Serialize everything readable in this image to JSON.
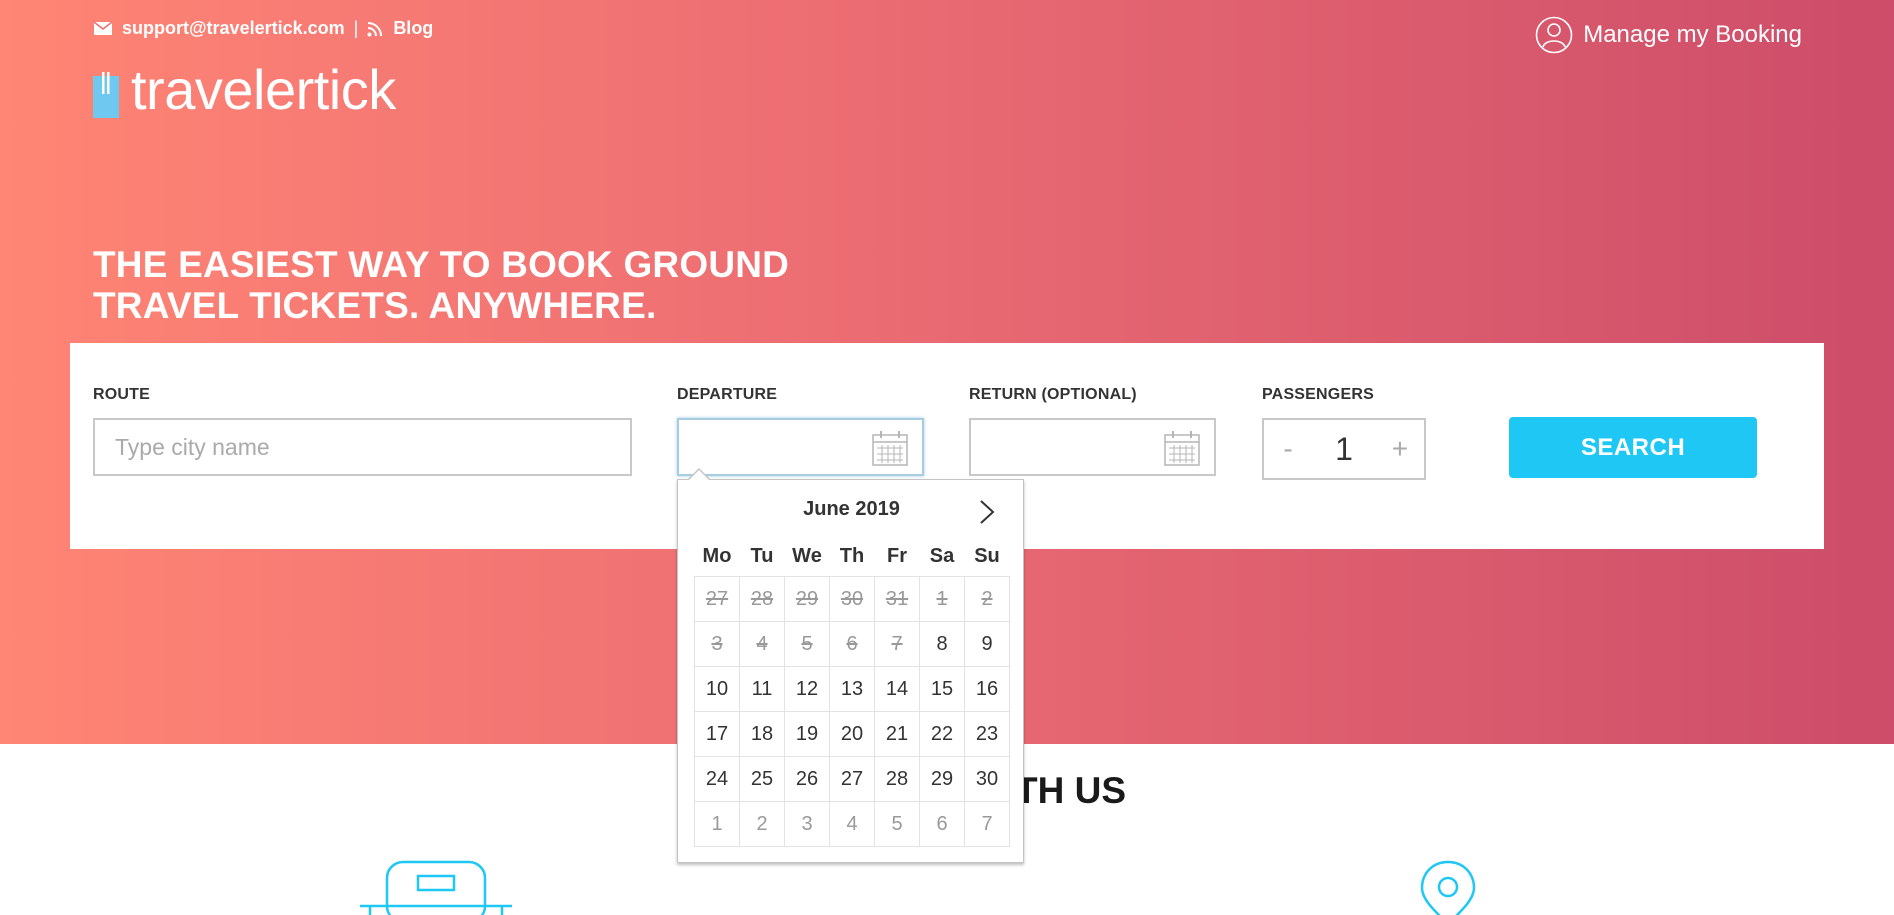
{
  "header": {
    "email": "support@travelertick.com",
    "separator": "|",
    "blog": "Blog",
    "manage_booking": "Manage my Booking",
    "logo_text": "travelertick"
  },
  "hero": {
    "headline_line1": "THE EASIEST WAY TO BOOK GROUND",
    "headline_line2": "TRAVEL TICKETS. ANYWHERE."
  },
  "search_form": {
    "route_label": "ROUTE",
    "route_placeholder": "Type city name",
    "route_value": "",
    "departure_label": "DEPARTURE",
    "departure_value": "",
    "return_label": "RETURN (OPTIONAL)",
    "return_value": "",
    "passengers_label": "PASSENGERS",
    "passengers_minus": "-",
    "passengers_value": "1",
    "passengers_plus": "+",
    "search_button": "SEARCH"
  },
  "below": {
    "section_title_visible": "TH US"
  },
  "datepicker": {
    "month_label": "June 2019",
    "weekdays": [
      "Mo",
      "Tu",
      "We",
      "Th",
      "Fr",
      "Sa",
      "Su"
    ],
    "weeks": [
      [
        {
          "d": "27",
          "s": "past"
        },
        {
          "d": "28",
          "s": "past"
        },
        {
          "d": "29",
          "s": "past"
        },
        {
          "d": "30",
          "s": "past"
        },
        {
          "d": "31",
          "s": "past"
        },
        {
          "d": "1",
          "s": "past"
        },
        {
          "d": "2",
          "s": "past"
        }
      ],
      [
        {
          "d": "3",
          "s": "past"
        },
        {
          "d": "4",
          "s": "past"
        },
        {
          "d": "5",
          "s": "past"
        },
        {
          "d": "6",
          "s": "past"
        },
        {
          "d": "7",
          "s": "past"
        },
        {
          "d": "8",
          "s": "avail"
        },
        {
          "d": "9",
          "s": "avail"
        }
      ],
      [
        {
          "d": "10",
          "s": "avail"
        },
        {
          "d": "11",
          "s": "avail"
        },
        {
          "d": "12",
          "s": "avail"
        },
        {
          "d": "13",
          "s": "avail"
        },
        {
          "d": "14",
          "s": "avail"
        },
        {
          "d": "15",
          "s": "avail"
        },
        {
          "d": "16",
          "s": "avail"
        }
      ],
      [
        {
          "d": "17",
          "s": "avail"
        },
        {
          "d": "18",
          "s": "avail"
        },
        {
          "d": "19",
          "s": "avail"
        },
        {
          "d": "20",
          "s": "avail"
        },
        {
          "d": "21",
          "s": "avail"
        },
        {
          "d": "22",
          "s": "avail"
        },
        {
          "d": "23",
          "s": "avail"
        }
      ],
      [
        {
          "d": "24",
          "s": "avail"
        },
        {
          "d": "25",
          "s": "avail"
        },
        {
          "d": "26",
          "s": "avail"
        },
        {
          "d": "27",
          "s": "avail"
        },
        {
          "d": "28",
          "s": "avail"
        },
        {
          "d": "29",
          "s": "avail"
        },
        {
          "d": "30",
          "s": "avail"
        }
      ],
      [
        {
          "d": "1",
          "s": "next"
        },
        {
          "d": "2",
          "s": "next"
        },
        {
          "d": "3",
          "s": "next"
        },
        {
          "d": "4",
          "s": "next"
        },
        {
          "d": "5",
          "s": "next"
        },
        {
          "d": "6",
          "s": "next"
        },
        {
          "d": "7",
          "s": "next"
        }
      ]
    ]
  },
  "colors": {
    "gradient_start": "#ff8574",
    "gradient_end": "#cd4d6a",
    "accent": "#1fc8f4"
  },
  "icons": [
    "mail-icon",
    "rss-icon",
    "user-icon",
    "logo-icon",
    "calendar-icon",
    "chevron-right-icon",
    "luggage-icon",
    "map-pin-icon"
  ]
}
